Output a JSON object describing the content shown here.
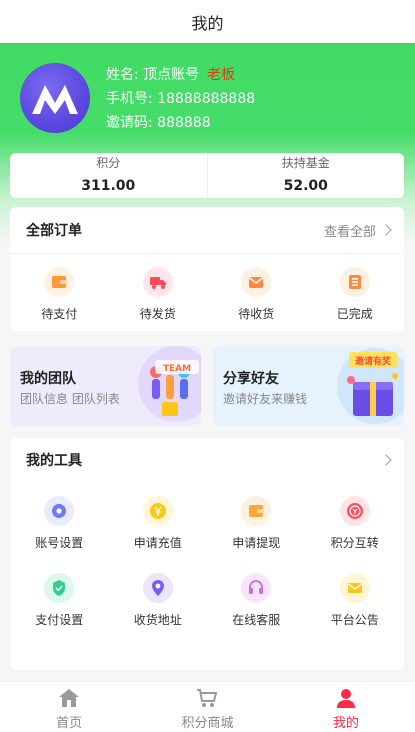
{
  "header": {
    "title": "我的"
  },
  "profile": {
    "name_line": "姓名: 顶点账号",
    "role": "老板",
    "phone_line": "手机号: 18888888888",
    "invite_line": "邀请码: 888888"
  },
  "stats": [
    {
      "label": "积分",
      "value": "311.00"
    },
    {
      "label": "扶持基金",
      "value": "52.00"
    }
  ],
  "orders": {
    "title": "全部订单",
    "more": "查看全部",
    "items": [
      {
        "label": "待支付",
        "icon": "wallet-icon",
        "color": "#ff9a3c"
      },
      {
        "label": "待发货",
        "icon": "truck-icon",
        "color": "#ff4a5a"
      },
      {
        "label": "待收货",
        "icon": "mail-icon",
        "color": "#ff8a3d"
      },
      {
        "label": "已完成",
        "icon": "checklist-icon",
        "color": "#ff8b3d"
      }
    ]
  },
  "promos": [
    {
      "title": "我的团队",
      "subtitle": "团队信息 团队列表",
      "illustration": "team-illustration",
      "illustration_text": "TEAM"
    },
    {
      "title": "分享好友",
      "subtitle": "邀请好友来赚钱",
      "illustration": "gift-illustration",
      "illustration_text": "邀请有奖"
    }
  ],
  "tools": {
    "title": "我的工具",
    "items": [
      {
        "label": "账号设置",
        "icon": "gear-icon",
        "color": "#6b7cf6"
      },
      {
        "label": "申请充值",
        "icon": "yen-icon",
        "color": "#ffc61a"
      },
      {
        "label": "申请提现",
        "icon": "wallet-icon",
        "color": "#ffa53a"
      },
      {
        "label": "积分互转",
        "icon": "exchange-icon",
        "color": "#ff4d5e"
      },
      {
        "label": "支付设置",
        "icon": "shield-check-icon",
        "color": "#2fcf8e"
      },
      {
        "label": "收货地址",
        "icon": "location-pin-icon",
        "color": "#7c5cf2"
      },
      {
        "label": "在线客服",
        "icon": "headset-icon",
        "color": "#c26cf0"
      },
      {
        "label": "平台公告",
        "icon": "envelope-icon",
        "color": "#ffc61a"
      }
    ]
  },
  "tabbar": [
    {
      "label": "首页",
      "icon": "home-icon",
      "active": false
    },
    {
      "label": "积分商城",
      "icon": "cart-icon",
      "active": false
    },
    {
      "label": "我的",
      "icon": "user-icon",
      "active": true
    }
  ],
  "colors": {
    "brand_green": "#41db63",
    "active_red": "#ff2a44",
    "role_orange": "#e8390e"
  }
}
